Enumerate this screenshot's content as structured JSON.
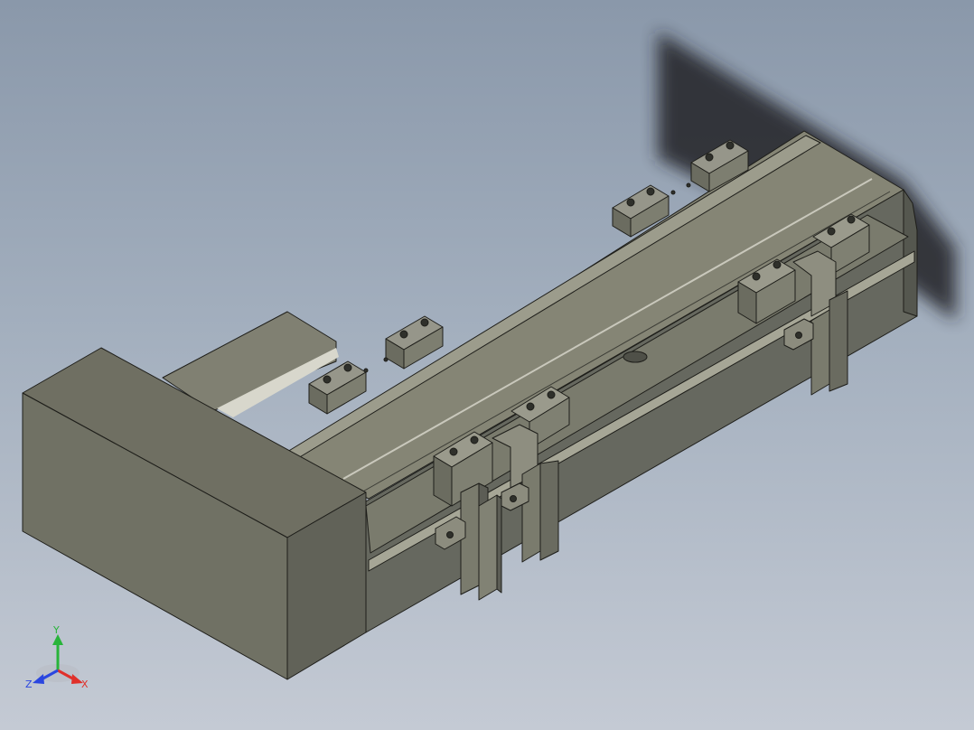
{
  "viewport": {
    "background_top": "#8a98aa",
    "background_bottom": "#c4cad4"
  },
  "model": {
    "body_color": "#6e6f62",
    "face_light": "#8c8c7c",
    "face_mid": "#767667",
    "face_dark": "#5b5d56",
    "edge_color": "#1e1e1a",
    "rail_highlight": "#c9c8bc"
  },
  "triad": {
    "x_label": "X",
    "y_label": "Y",
    "z_label": "Z",
    "x_color": "#e0302a",
    "y_color": "#28b43a",
    "z_color": "#2a46e0"
  }
}
